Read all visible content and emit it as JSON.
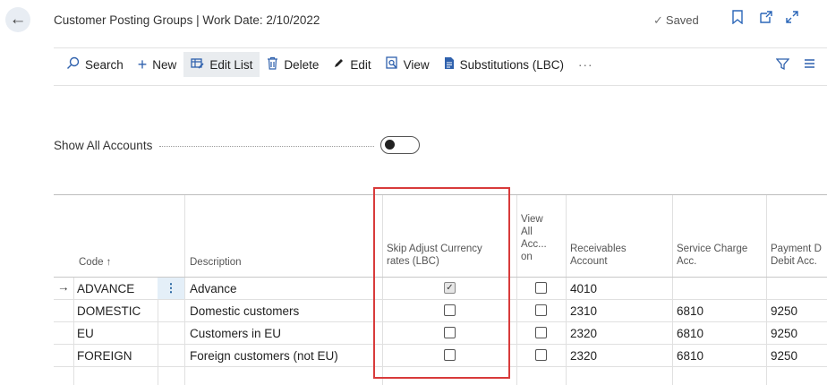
{
  "header": {
    "title": "Customer Posting Groups | Work Date: 2/10/2022",
    "saved_label": "Saved",
    "saved_icon": "checkmark-icon",
    "icons": [
      "bookmark-icon",
      "open-new-window-icon",
      "expand-icon"
    ]
  },
  "toolbar": {
    "items": [
      {
        "label": "Search",
        "icon": "search-icon"
      },
      {
        "label": "New",
        "icon": "plus-icon"
      },
      {
        "label": "Edit List",
        "icon": "edit-list-icon",
        "active": true
      },
      {
        "label": "Delete",
        "icon": "trash-icon"
      },
      {
        "label": "Edit",
        "icon": "pencil-icon"
      },
      {
        "label": "View",
        "icon": "view-icon"
      },
      {
        "label": "Substitutions (LBC)",
        "icon": "document-icon"
      }
    ],
    "more_label": "···",
    "right_icons": [
      "filter-icon",
      "list-icon"
    ]
  },
  "show_all": {
    "label": "Show All Accounts",
    "value": false
  },
  "table": {
    "headers": {
      "code": "Code ↑",
      "description": "Description",
      "skip_adjust": [
        "Skip Adjust Currency",
        "rates (LBC)"
      ],
      "view_all": [
        "View",
        "All",
        "Acc...",
        "on"
      ],
      "receivables": [
        "Receivables",
        "Account"
      ],
      "service_charge": [
        "Service Charge",
        "Acc."
      ],
      "payment": [
        "Payment D",
        "Debit Acc."
      ]
    },
    "rows": [
      {
        "code": "ADVANCE",
        "description": "Advance",
        "skip_adjust": true,
        "view_all": false,
        "receivables": "4010",
        "service_charge": "",
        "payment": "",
        "selected": true
      },
      {
        "code": "DOMESTIC",
        "description": "Domestic customers",
        "skip_adjust": false,
        "view_all": false,
        "receivables": "2310",
        "service_charge": "6810",
        "payment": "9250",
        "selected": false
      },
      {
        "code": "EU",
        "description": "Customers in EU",
        "skip_adjust": false,
        "view_all": false,
        "receivables": "2320",
        "service_charge": "6810",
        "payment": "9250",
        "selected": false
      },
      {
        "code": "FOREIGN",
        "description": "Foreign customers (not EU)",
        "skip_adjust": false,
        "view_all": false,
        "receivables": "2320",
        "service_charge": "6810",
        "payment": "9250",
        "selected": false
      }
    ],
    "row_marker": "→",
    "row_actions": "⋮"
  },
  "colors": {
    "accent": "#2f61ad",
    "highlight": "#d83b3b",
    "selected_cell": "#e4eff8"
  }
}
